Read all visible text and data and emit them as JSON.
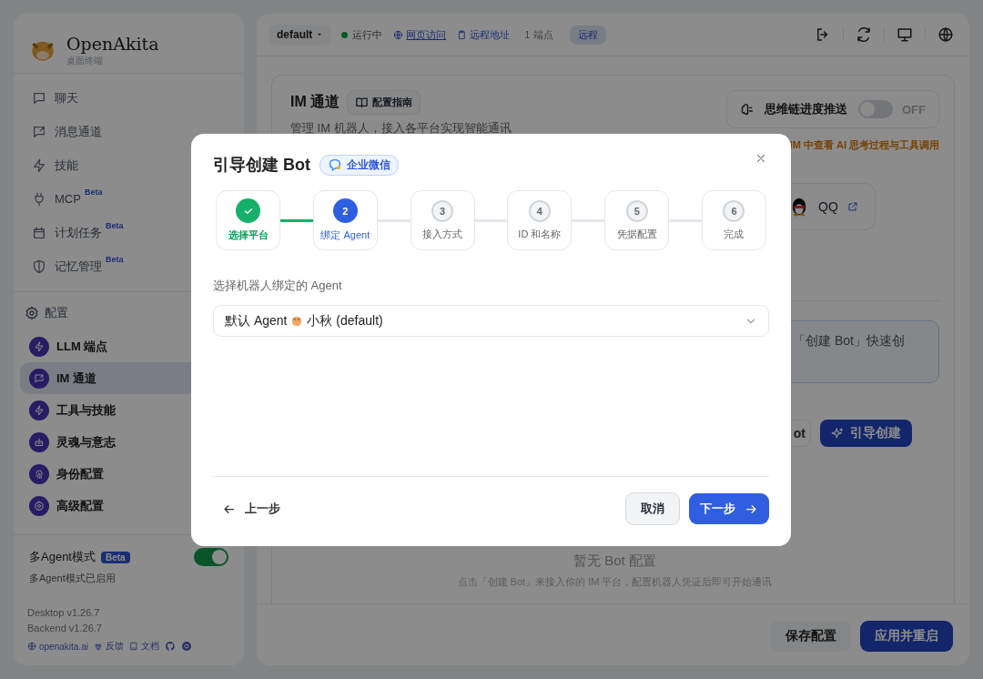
{
  "sidebar": {
    "brand": {
      "name": "OpenAkita",
      "subtitle": "桌面终端"
    },
    "nav_items": [
      {
        "label": "聊天"
      },
      {
        "label": "消息通道"
      },
      {
        "label": "技能"
      },
      {
        "label": "MCP",
        "badge": "Beta"
      },
      {
        "label": "计划任务",
        "badge": "Beta"
      },
      {
        "label": "记忆管理",
        "badge": "Beta"
      }
    ],
    "config_section": {
      "title": "配置",
      "items": [
        {
          "label": "LLM 端点",
          "selected": false
        },
        {
          "label": "IM 通道",
          "selected": true
        },
        {
          "label": "工具与技能",
          "selected": false
        },
        {
          "label": "灵魂与意志",
          "selected": false
        },
        {
          "label": "身份配置",
          "selected": false
        },
        {
          "label": "高级配置",
          "selected": false
        }
      ]
    },
    "multi_agent": {
      "label": "多Agent模式",
      "badge": "Beta",
      "on": true,
      "status": "多Agent模式已启用"
    },
    "versions": [
      "Desktop v1.26.7",
      "Backend v1.26.7"
    ],
    "footer_links": [
      {
        "label": "openakita.ai"
      },
      {
        "label": "反馈"
      },
      {
        "label": "文档"
      }
    ]
  },
  "header": {
    "workspace": "default",
    "status": {
      "label": "运行中",
      "running": true
    },
    "web_link": "网页访问",
    "remote_link": "远程地址",
    "endpoints": "1 端点",
    "mode_badge": "远程"
  },
  "im_card": {
    "title": "IM 通道",
    "guide_button": "配置指南",
    "description": "管理 IM 机器人，接入各平台实现智能通讯",
    "thinking_push": {
      "label": "思维链进度推送",
      "on": false,
      "state_text": "OFF"
    },
    "thinking_hint": "IM 中查看 AI 思考过程与工具调用",
    "platform": {
      "name": "QQ"
    },
    "info_text": "「创建 Bot」快速创",
    "buttons": [
      {
        "label": "ot",
        "kind": "secondary"
      },
      {
        "label": "引导创建",
        "kind": "primary"
      }
    ],
    "empty_state": {
      "title": "暂无 Bot 配置",
      "description": "点击「创建 Bot」来接入你的 IM 平台，配置机器人凭证后即可开始通讯"
    }
  },
  "footer": {
    "buttons": [
      {
        "label": "保存配置",
        "kind": "secondary"
      },
      {
        "label": "应用并重启",
        "kind": "primary"
      }
    ]
  },
  "modal": {
    "title": "引导创建 Bot",
    "platform_badge": "企业微信",
    "steps": [
      {
        "label": "选择平台",
        "done": true,
        "current": false
      },
      {
        "number": "2",
        "label": "绑定 Agent",
        "done": false,
        "current": true
      },
      {
        "number": "3",
        "label": "接入方式",
        "done": false,
        "current": false
      },
      {
        "number": "4",
        "label": "ID 和名称",
        "done": false,
        "current": false
      },
      {
        "number": "5",
        "label": "凭据配置",
        "done": false,
        "current": false
      },
      {
        "number": "6",
        "label": "完成",
        "done": false,
        "current": false
      }
    ],
    "field_label": "选择机器人绑定的 Agent",
    "agent_select": {
      "value": "默认 Agent",
      "detail": "小秋 (default)"
    },
    "back_button": "上一步",
    "cancel_button": "取消",
    "next_button": "下一步"
  }
}
